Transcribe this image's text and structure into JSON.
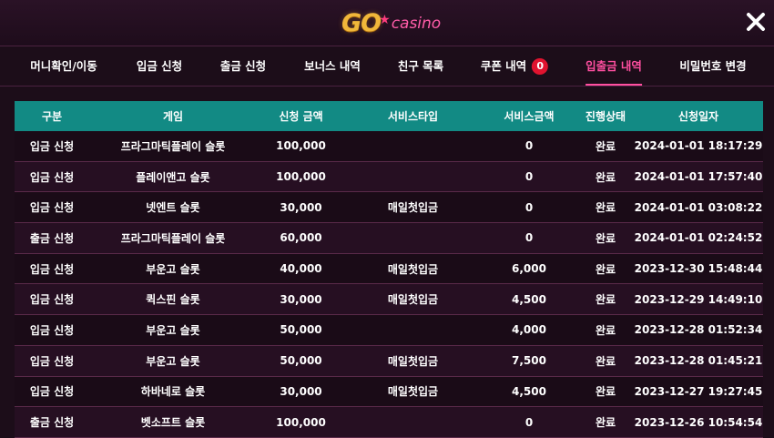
{
  "header": {
    "logo_go": "GO",
    "logo_casino": "casino",
    "close_icon": "close-icon"
  },
  "nav": {
    "tabs": [
      {
        "label": "머니확인/이동",
        "active": false
      },
      {
        "label": "입금 신청",
        "active": false
      },
      {
        "label": "출금 신청",
        "active": false
      },
      {
        "label": "보너스 내역",
        "active": false
      },
      {
        "label": "친구 목록",
        "active": false
      },
      {
        "label": "쿠폰 내역",
        "active": false,
        "badge": "0"
      },
      {
        "label": "입출금 내역",
        "active": true
      },
      {
        "label": "비밀번호 변경",
        "active": false
      }
    ]
  },
  "table": {
    "columns": [
      "구분",
      "게임",
      "신청 금액",
      "서비스타입",
      "서비스금액",
      "진행상태",
      "신청일자"
    ],
    "rows": [
      [
        "입금 신청",
        "프라그마틱플레이 슬롯",
        "100,000",
        "",
        "0",
        "완료",
        "2024-01-01 18:17:29"
      ],
      [
        "입금 신청",
        "플레이앤고 슬롯",
        "100,000",
        "",
        "0",
        "완료",
        "2024-01-01 17:57:40"
      ],
      [
        "입금 신청",
        "넷엔트 슬롯",
        "30,000",
        "매일첫입금",
        "0",
        "완료",
        "2024-01-01 03:08:22"
      ],
      [
        "출금 신청",
        "프라그마틱플레이 슬롯",
        "60,000",
        "",
        "0",
        "완료",
        "2024-01-01 02:24:52"
      ],
      [
        "입금 신청",
        "부운고 슬롯",
        "40,000",
        "매일첫입금",
        "6,000",
        "완료",
        "2023-12-30 15:48:44"
      ],
      [
        "입금 신청",
        "퀵스핀 슬롯",
        "30,000",
        "매일첫입금",
        "4,500",
        "완료",
        "2023-12-29 14:49:10"
      ],
      [
        "입금 신청",
        "부운고 슬롯",
        "50,000",
        "",
        "4,000",
        "완료",
        "2023-12-28 01:52:34"
      ],
      [
        "입금 신청",
        "부운고 슬롯",
        "50,000",
        "매일첫입금",
        "7,500",
        "완료",
        "2023-12-28 01:45:21"
      ],
      [
        "입금 신청",
        "하바네로 슬롯",
        "30,000",
        "매일첫입금",
        "4,500",
        "완료",
        "2023-12-27 19:27:45"
      ],
      [
        "출금 신청",
        "벳소프트 슬롯",
        "100,000",
        "",
        "0",
        "완료",
        "2023-12-26 10:54:54"
      ]
    ]
  },
  "colors": {
    "background": "#1c0d19",
    "header_teal": "#128a84",
    "active_pink": "#ff4fa0",
    "badge_red": "#e0132f",
    "logo_gold": "#f0b73a"
  }
}
